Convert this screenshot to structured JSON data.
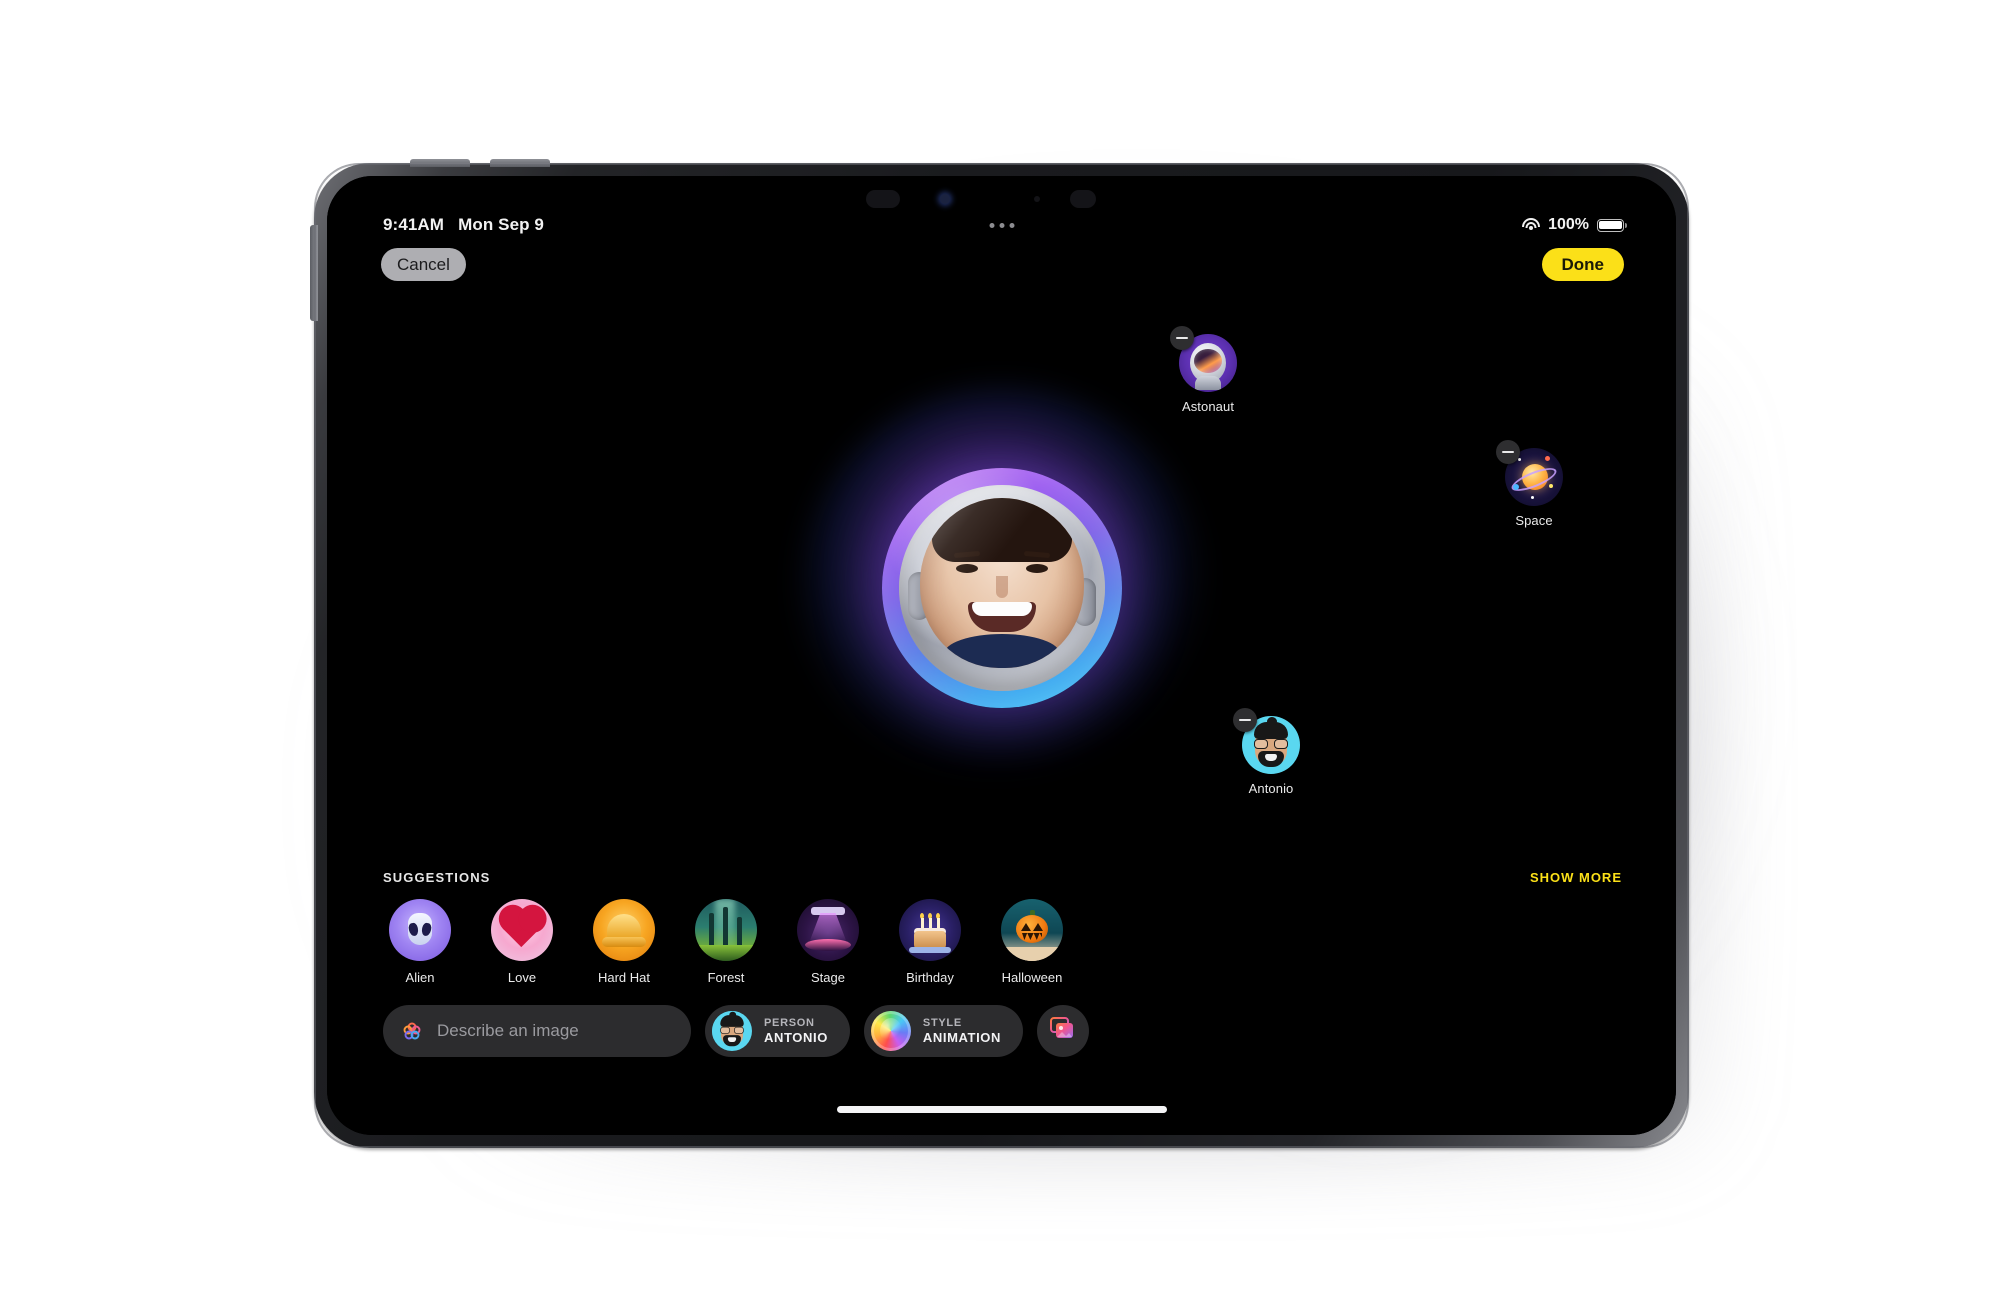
{
  "device": {
    "name": "ipad-pro",
    "status_bar": {
      "time": "9:41AM",
      "date": "Mon Sep 9",
      "battery_percent": "100%",
      "wifi_icon": "wifi-icon",
      "battery_icon": "battery-full-icon",
      "multitask_indicator": "multitasking-dots"
    }
  },
  "header": {
    "cancel_label": "Cancel",
    "done_label": "Done"
  },
  "canvas": {
    "hero": {
      "name": "generated-astronaut-portrait",
      "alt": "Smiling person inside an astronaut helmet with purple and blue glow"
    },
    "chips": [
      {
        "id": "astronaut",
        "label": "Astonaut",
        "icon": "astronaut-helmet-icon",
        "remove_label": "remove"
      },
      {
        "id": "space",
        "label": "Space",
        "icon": "planet-saturn-icon",
        "remove_label": "remove"
      },
      {
        "id": "antonio",
        "label": "Antonio",
        "icon": "memoji-avatar-icon",
        "remove_label": "remove"
      }
    ]
  },
  "suggestions": {
    "title": "SUGGESTIONS",
    "show_more_label": "SHOW MORE",
    "items": [
      {
        "label": "Alien",
        "art": "alien-head-icon"
      },
      {
        "label": "Love",
        "art": "heart-icon"
      },
      {
        "label": "Hard Hat",
        "art": "hard-hat-icon"
      },
      {
        "label": "Forest",
        "art": "forest-icon"
      },
      {
        "label": "Stage",
        "art": "stage-lights-icon"
      },
      {
        "label": "Birthday",
        "art": "birthday-cake-icon"
      },
      {
        "label": "Halloween",
        "art": "jack-o-lantern-icon"
      }
    ]
  },
  "toolbar": {
    "describe_placeholder": "Describe an image",
    "describe_icon": "image-playground-icon",
    "person": {
      "key": "PERSON",
      "value": "ANTONIO",
      "avatar": "memoji-avatar-icon"
    },
    "style": {
      "key": "STYLE",
      "value": "ANIMATION",
      "avatar": "style-sphere-icon"
    },
    "photo_picker_icon": "photo-library-icon"
  },
  "colors": {
    "accent_yellow": "#fbe018",
    "cancel_gray": "#aeaeb2",
    "surface": "#2c2c2e",
    "screen_bg": "#000000"
  }
}
